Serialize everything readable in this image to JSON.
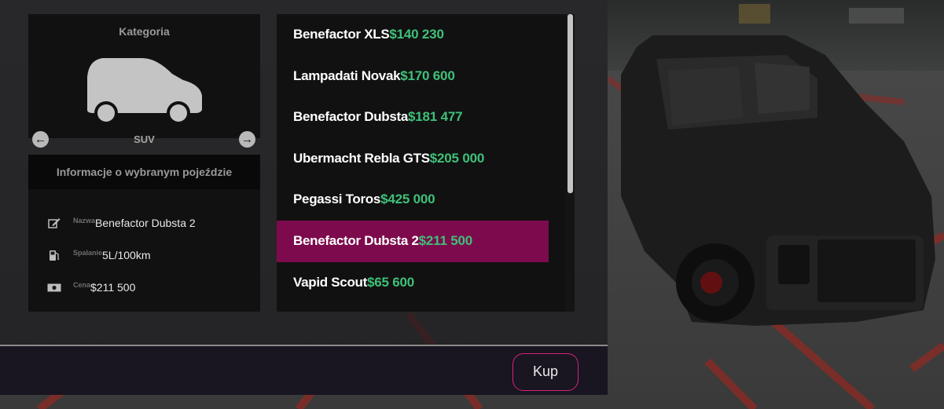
{
  "category": {
    "title": "Kategoria",
    "current": "SUV",
    "icon": "suv-car-icon"
  },
  "info": {
    "title": "Informacje o wybranym pojeździe",
    "rows": [
      {
        "icon": "edit-icon",
        "label": "Nazwa",
        "value": "Benefactor Dubsta 2"
      },
      {
        "icon": "fuel-pump-icon",
        "label": "Spalanie",
        "value": "5L/100km"
      },
      {
        "icon": "money-icon",
        "label": "Cena",
        "value": "$211 500"
      }
    ]
  },
  "vehicles": [
    {
      "name": "Benefactor XLS",
      "price": "$140 230",
      "selected": false
    },
    {
      "name": "Lampadati Novak",
      "price": "$170 600",
      "selected": false
    },
    {
      "name": "Benefactor Dubsta",
      "price": "$181 477",
      "selected": false
    },
    {
      "name": "Ubermacht Rebla GTS",
      "price": "$205 000",
      "selected": false
    },
    {
      "name": "Pegassi Toros",
      "price": "$425 000",
      "selected": false
    },
    {
      "name": "Benefactor Dubsta 2",
      "price": "$211 500",
      "selected": true
    },
    {
      "name": "Vapid Scout",
      "price": "$65 600",
      "selected": false
    }
  ],
  "footer": {
    "buy_label": "Kup"
  },
  "colors": {
    "selected": "#7d0a4d",
    "price": "#3fc079",
    "buy_border": "#d4237c"
  }
}
